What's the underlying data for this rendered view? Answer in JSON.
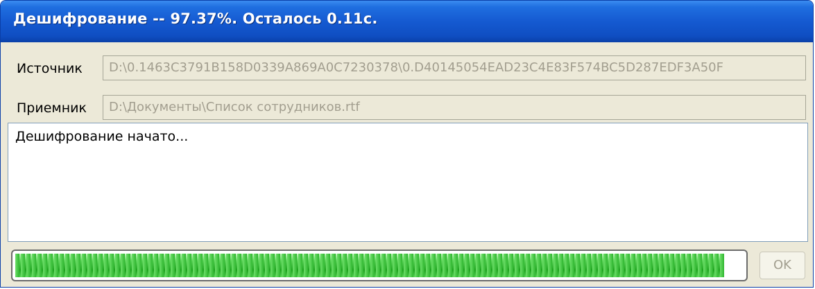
{
  "window": {
    "title": "Дешифрование -- 97.37%. Осталось 0.11с."
  },
  "source": {
    "label": "Источник",
    "value": "D:\\0.1463C3791B158D0339A869A0C7230378\\0.D40145054EAD23C4E83F574BC5D287EDF3A50F"
  },
  "destination": {
    "label": "Приемник",
    "value": "D:\\Документы\\Список сотрудников.rtf"
  },
  "log": {
    "text": "Дешифрование начато..."
  },
  "progress": {
    "percent": 97.37,
    "color": "#3cc13c"
  },
  "buttons": {
    "ok_label": "OK"
  },
  "colors": {
    "titlebar": "#155ad1",
    "window_bg": "#ece9d8",
    "disabled_text": "#a29e8f"
  }
}
